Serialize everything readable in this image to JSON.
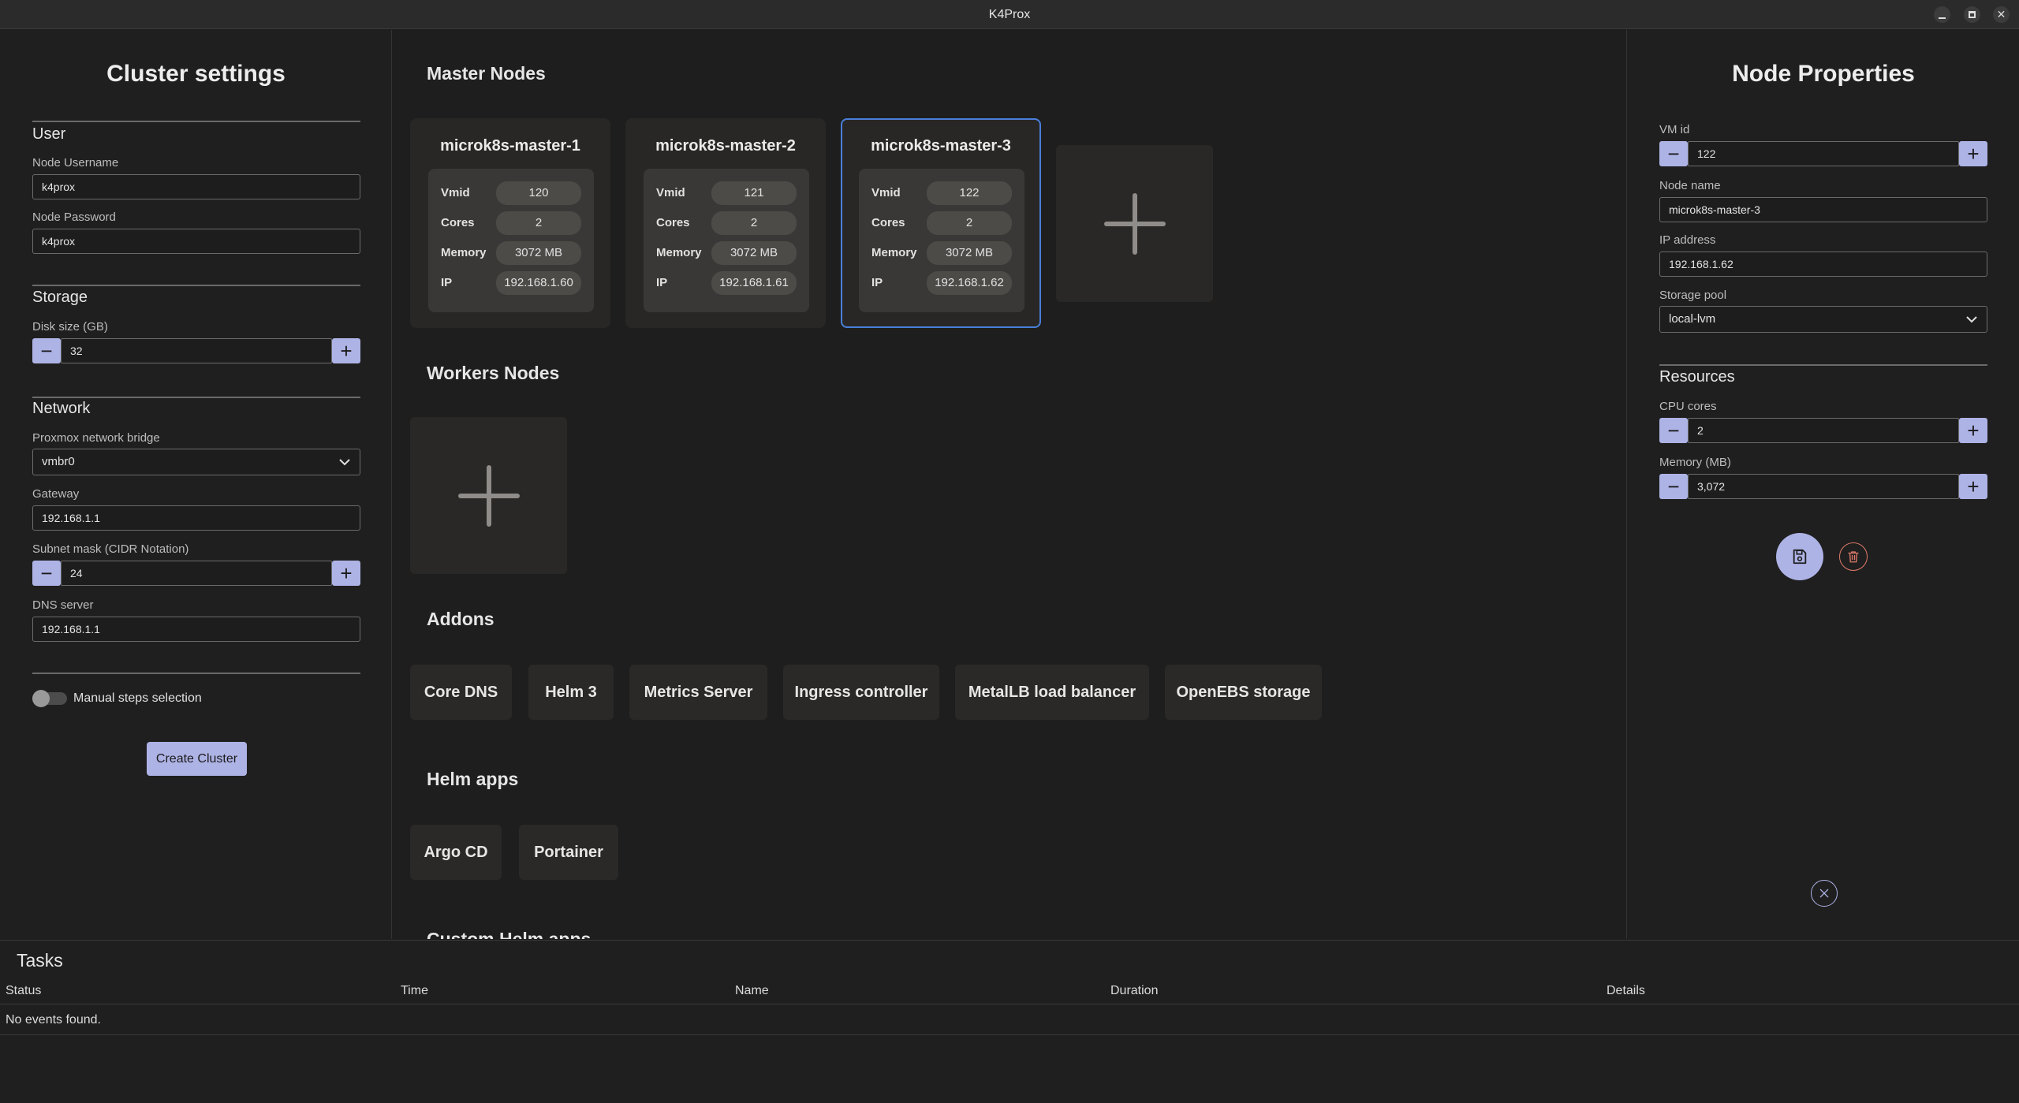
{
  "window": {
    "title": "K4Prox"
  },
  "cluster_settings": {
    "title": "Cluster settings",
    "user": {
      "heading": "User",
      "username_label": "Node Username",
      "username_value": "k4prox",
      "password_label": "Node Password",
      "password_value": "k4prox"
    },
    "storage": {
      "heading": "Storage",
      "disk_label": "Disk size (GB)",
      "disk_value": "32"
    },
    "network": {
      "heading": "Network",
      "bridge_label": "Proxmox network bridge",
      "bridge_value": "vmbr0",
      "gateway_label": "Gateway",
      "gateway_value": "192.168.1.1",
      "subnet_label": "Subnet mask (CIDR Notation)",
      "subnet_value": "24",
      "dns_label": "DNS server",
      "dns_value": "192.168.1.1"
    },
    "manual_steps_label": "Manual steps selection",
    "manual_steps_enabled": false,
    "create_button": "Create Cluster"
  },
  "main": {
    "master_title": "Master Nodes",
    "master_nodes": [
      {
        "name": "microk8s-master-1",
        "vmid": "120",
        "cores": "2",
        "memory": "3072 MB",
        "ip": "192.168.1.60",
        "selected": false
      },
      {
        "name": "microk8s-master-2",
        "vmid": "121",
        "cores": "2",
        "memory": "3072 MB",
        "ip": "192.168.1.61",
        "selected": false
      },
      {
        "name": "microk8s-master-3",
        "vmid": "122",
        "cores": "2",
        "memory": "3072 MB",
        "ip": "192.168.1.62",
        "selected": true
      }
    ],
    "node_field_labels": {
      "vmid": "Vmid",
      "cores": "Cores",
      "memory": "Memory",
      "ip": "IP"
    },
    "workers_title": "Workers Nodes",
    "addons_title": "Addons",
    "addons": [
      "Core DNS",
      "Helm 3",
      "Metrics Server",
      "Ingress controller",
      "MetalLB load balancer",
      "OpenEBS storage"
    ],
    "helm_apps_title": "Helm apps",
    "helm_apps": [
      "Argo CD",
      "Portainer"
    ],
    "custom_helm_title": "Custom Helm apps"
  },
  "node_properties": {
    "title": "Node Properties",
    "vmid_label": "VM id",
    "vmid_value": "122",
    "name_label": "Node name",
    "name_value": "microk8s-master-3",
    "ip_label": "IP address",
    "ip_value": "192.168.1.62",
    "pool_label": "Storage pool",
    "pool_value": "local-lvm",
    "resources_heading": "Resources",
    "cpu_label": "CPU cores",
    "cpu_value": "2",
    "memory_label": "Memory (MB)",
    "memory_value": "3,072"
  },
  "tasks": {
    "title": "Tasks",
    "columns": [
      "Status",
      "Time",
      "Name",
      "Duration",
      "Details"
    ],
    "empty_text": "No events found."
  },
  "colors": {
    "accent": "#aeb3e6",
    "selection_border": "#4a7fd9",
    "delete": "#e07a6a"
  }
}
